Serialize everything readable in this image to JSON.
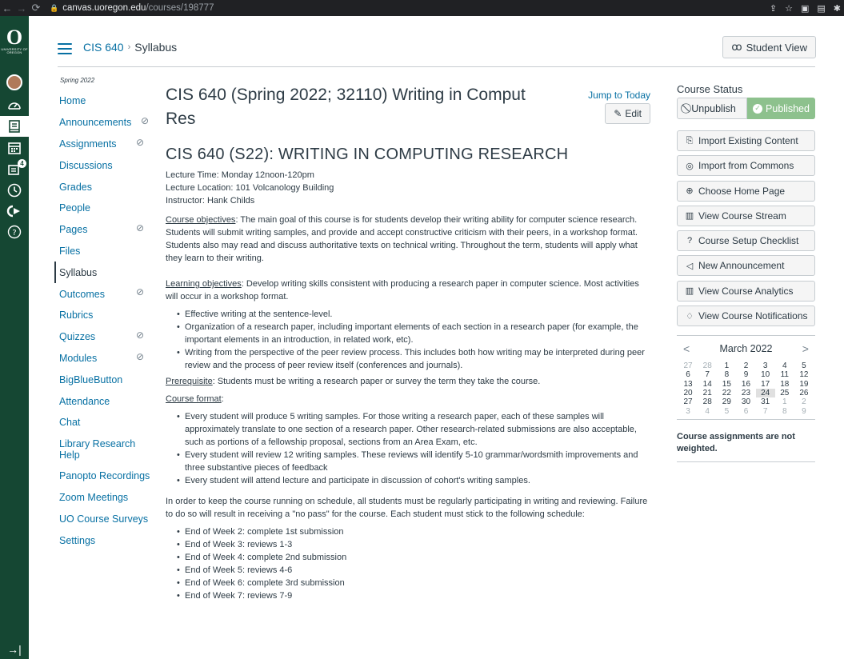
{
  "browser": {
    "host": "canvas.uoregon.edu",
    "path": "/courses/198777"
  },
  "logo": {
    "letter": "O",
    "text": "UNIVERSITY OF OREGON"
  },
  "global_nav": {
    "inbox_badge": "4"
  },
  "header": {
    "breadcrumb_course": "CIS 640",
    "breadcrumb_separator": "›",
    "breadcrumb_page": "Syllabus",
    "student_view": "Student View"
  },
  "course_nav": {
    "term": "Spring 2022",
    "items": [
      {
        "label": "Home"
      },
      {
        "label": "Announcements"
      },
      {
        "label": "Assignments"
      },
      {
        "label": "Discussions"
      },
      {
        "label": "Grades"
      },
      {
        "label": "People"
      },
      {
        "label": "Pages"
      },
      {
        "label": "Files"
      },
      {
        "label": "Syllabus"
      },
      {
        "label": "Outcomes"
      },
      {
        "label": "Rubrics"
      },
      {
        "label": "Quizzes"
      },
      {
        "label": "Modules"
      },
      {
        "label": "BigBlueButton"
      },
      {
        "label": "Attendance"
      },
      {
        "label": "Chat"
      },
      {
        "label": "Library Research Help"
      },
      {
        "label": "Panopto Recordings"
      },
      {
        "label": "Zoom Meetings"
      },
      {
        "label": "UO Course Surveys"
      },
      {
        "label": "Settings"
      }
    ]
  },
  "main": {
    "title": "CIS 640 (Spring 2022; 32110) Writing in Comput Res",
    "jump_to_today": "Jump to Today",
    "edit": "Edit",
    "heading": "CIS 640 (S22): WRITING IN COMPUTING RESEARCH",
    "lecture_time": "Lecture Time: Monday 12noon-120pm",
    "lecture_location": "Lecture Location: 101 Volcanology Building",
    "instructor": "Instructor: Hank Childs",
    "course_objectives_label": "Course objectives",
    "course_objectives_text": ": The main goal of this course is for students develop their writing ability for computer science research. Students will submit writing samples, and provide and accept constructive criticism with their peers, in a workshop format. Students also may read and discuss authoritative texts on technical writing. Throughout the term, students will apply what they learn to their writing.",
    "learning_objectives_label": "Learning objectives",
    "learning_objectives_text": ": Develop writing skills consistent with producing a research paper in computer science. Most activities will occur in a workshop format.",
    "learning_bullets": [
      "Effective writing at the sentence-level.",
      "Organization of a research paper, including important elements of each section in a research paper (for example, the important elements in an introduction, in related work, etc).",
      "Writing from the perspective of the peer review process. This includes both how writing may be interpreted during peer review and the process of peer review itself (conferences and journals)."
    ],
    "prerequisite_label": "Prerequisite",
    "prerequisite_text": ": Students must be writing a research paper or survey the term they take the course.",
    "course_format_label": "Course format",
    "course_format_colon": ":",
    "format_bullets": [
      "Every student will produce 5 writing samples. For those writing a research paper, each of these samples will approximately translate to one section of a research paper. Other research-related submissions are also acceptable, such as portions of a fellowship proposal, sections from an Area Exam, etc.",
      "Every student will review 12 writing samples. These reviews will identify 5-10 grammar/wordsmith improvements and three substantive pieces of feedback",
      "Every student will attend lecture and participate in discussion of cohort's writing samples."
    ],
    "schedule_intro": "In order to keep the course running on schedule, all students must be regularly participating in writing and reviewing. Failure to do so will result in receiving a \"no pass\" for the course. Each student must stick to the following schedule:",
    "schedule": [
      "End of Week 2: complete 1st submission",
      "End of Week 3: reviews 1-3",
      "End of Week 4: complete 2nd submission",
      "End of Week 5: reviews 4-6",
      "End of Week 6: complete 3rd submission",
      "End of Week 7: reviews 7-9"
    ]
  },
  "sidebar": {
    "course_status": "Course Status",
    "unpublish": "Unpublish",
    "published": "Published",
    "buttons": [
      {
        "label": "Import Existing Content",
        "icon": "import-icon"
      },
      {
        "label": "Import from Commons",
        "icon": "commons-icon"
      },
      {
        "label": "Choose Home Page",
        "icon": "target-icon"
      },
      {
        "label": "View Course Stream",
        "icon": "stream-icon"
      },
      {
        "label": "Course Setup Checklist",
        "icon": "question-icon"
      },
      {
        "label": "New Announcement",
        "icon": "announcement-icon"
      },
      {
        "label": "View Course Analytics",
        "icon": "analytics-icon"
      },
      {
        "label": "View Course Notifications",
        "icon": "bell-icon"
      }
    ],
    "calendar": {
      "month": "March 2022",
      "days": [
        {
          "d": "27",
          "out": true
        },
        {
          "d": "28",
          "out": true
        },
        {
          "d": "1"
        },
        {
          "d": "2"
        },
        {
          "d": "3"
        },
        {
          "d": "4"
        },
        {
          "d": "5"
        },
        {
          "d": "6"
        },
        {
          "d": "7"
        },
        {
          "d": "8"
        },
        {
          "d": "9"
        },
        {
          "d": "10"
        },
        {
          "d": "11"
        },
        {
          "d": "12"
        },
        {
          "d": "13"
        },
        {
          "d": "14"
        },
        {
          "d": "15"
        },
        {
          "d": "16"
        },
        {
          "d": "17"
        },
        {
          "d": "18"
        },
        {
          "d": "19"
        },
        {
          "d": "20"
        },
        {
          "d": "21"
        },
        {
          "d": "22"
        },
        {
          "d": "23"
        },
        {
          "d": "24",
          "today": true
        },
        {
          "d": "25"
        },
        {
          "d": "26"
        },
        {
          "d": "27"
        },
        {
          "d": "28"
        },
        {
          "d": "29"
        },
        {
          "d": "30"
        },
        {
          "d": "31"
        },
        {
          "d": "1",
          "out": true
        },
        {
          "d": "2",
          "out": true
        },
        {
          "d": "3",
          "out": true
        },
        {
          "d": "4",
          "out": true
        },
        {
          "d": "5",
          "out": true
        },
        {
          "d": "6",
          "out": true
        },
        {
          "d": "7",
          "out": true
        },
        {
          "d": "8",
          "out": true
        },
        {
          "d": "9",
          "out": true
        }
      ]
    },
    "weighted_note": "Course assignments are not weighted."
  },
  "colors": {
    "brand_green": "#154733",
    "link_blue": "#0770a3",
    "published_green": "#8dc18d"
  }
}
